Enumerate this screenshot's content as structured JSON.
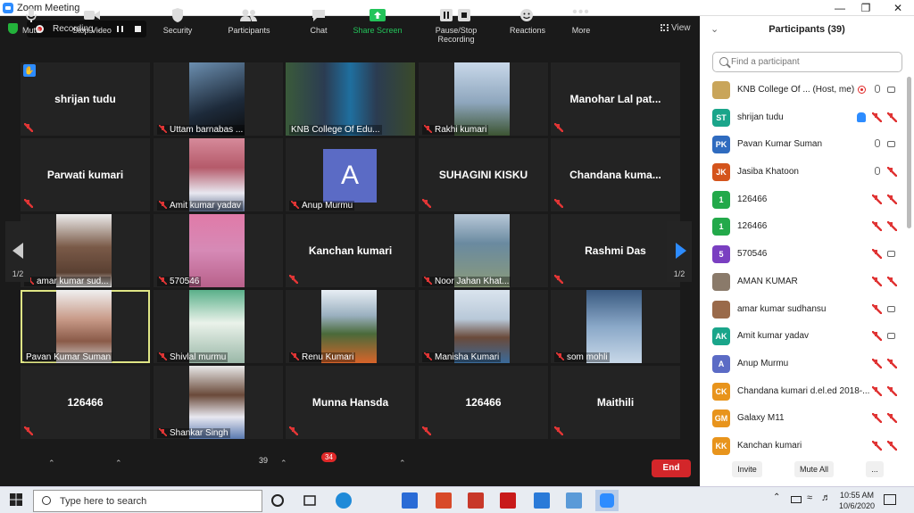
{
  "window": {
    "title": "Zoom Meeting"
  },
  "recording": {
    "label": "Recording..."
  },
  "view": {
    "label": "View"
  },
  "tiles": [
    {
      "name": "shrijan tudu",
      "label": ""
    },
    {
      "name": "",
      "label": "Uttam barnabas ..."
    },
    {
      "name": "",
      "label": "KNB College Of Edu..."
    },
    {
      "name": "",
      "label": "Rakhi kumari"
    },
    {
      "name": "Manohar Lal pat...",
      "label": ""
    },
    {
      "name": "Parwati kumari",
      "label": ""
    },
    {
      "name": "",
      "label": "Amit kumar yadav"
    },
    {
      "name": "",
      "label": "Anup Murmu",
      "avatar": "A"
    },
    {
      "name": "SUHAGINI KISKU",
      "label": ""
    },
    {
      "name": "Chandana kuma...",
      "label": ""
    },
    {
      "name": "",
      "label": "amar kumar sud..."
    },
    {
      "name": "",
      "label": "570546"
    },
    {
      "name": "Kanchan kumari",
      "label": ""
    },
    {
      "name": "",
      "label": "Noor Jahan Khat..."
    },
    {
      "name": "Rashmi Das",
      "label": ""
    },
    {
      "name": "",
      "label": "Pavan Kumar Suman"
    },
    {
      "name": "",
      "label": "Shivlal murmu"
    },
    {
      "name": "",
      "label": "Renu Kumari"
    },
    {
      "name": "",
      "label": "Manisha Kumari"
    },
    {
      "name": "",
      "label": "som mohli"
    },
    {
      "name": "126466",
      "label": ""
    },
    {
      "name": "",
      "label": "Shankar Singh"
    },
    {
      "name": "Munna Hansda",
      "label": ""
    },
    {
      "name": "126466",
      "label": ""
    },
    {
      "name": "Maithili",
      "label": ""
    }
  ],
  "pager": {
    "left": "1/2",
    "right": "1/2"
  },
  "toolbar": {
    "mute": "Mute",
    "stop_video": "Stop Video",
    "security": "Security",
    "participants": "Participants",
    "participants_count": "39",
    "chat": "Chat",
    "chat_badge": "34",
    "share_screen": "Share Screen",
    "pause_stop_recording": "Pause/Stop Recording",
    "reactions": "Reactions",
    "more": "More",
    "end": "End"
  },
  "panel": {
    "title": "Participants (39)",
    "search_placeholder": "Find a participant",
    "invite": "Invite",
    "mute_all": "Mute All",
    "more": "...",
    "participants": [
      {
        "initials": "",
        "name": "KNB College Of ... (Host, me)",
        "color": "#c9a55a",
        "mic": "on",
        "cam": "on",
        "extra": "rec"
      },
      {
        "initials": "ST",
        "name": "shrijan tudu",
        "color": "#1aa58a",
        "mic": "muted",
        "cam": "off",
        "extra": "hand"
      },
      {
        "initials": "PK",
        "name": "Pavan Kumar Suman",
        "color": "#2f6bbf",
        "mic": "on",
        "cam": "on",
        "extra": ""
      },
      {
        "initials": "JK",
        "name": "Jasiba Khatoon",
        "color": "#d4541c",
        "mic": "on",
        "cam": "off",
        "extra": ""
      },
      {
        "initials": "1",
        "name": "126466",
        "color": "#23a94a",
        "mic": "muted",
        "cam": "off",
        "extra": ""
      },
      {
        "initials": "1",
        "name": "126466",
        "color": "#23a94a",
        "mic": "muted",
        "cam": "off",
        "extra": ""
      },
      {
        "initials": "5",
        "name": "570546",
        "color": "#7a3fc1",
        "mic": "muted",
        "cam": "on",
        "extra": ""
      },
      {
        "initials": "",
        "name": "AMAN KUMAR",
        "color": "#8a7a6a",
        "mic": "muted",
        "cam": "off",
        "extra": ""
      },
      {
        "initials": "",
        "name": "amar kumar sudhansu",
        "color": "#9a6a4a",
        "mic": "muted",
        "cam": "on",
        "extra": ""
      },
      {
        "initials": "AK",
        "name": "Amit kumar yadav",
        "color": "#1aa58a",
        "mic": "muted",
        "cam": "on",
        "extra": ""
      },
      {
        "initials": "A",
        "name": "Anup Murmu",
        "color": "#5b6bc5",
        "mic": "muted",
        "cam": "off",
        "extra": ""
      },
      {
        "initials": "CK",
        "name": "Chandana kumari d.el.ed 2018-...",
        "color": "#e8941c",
        "mic": "muted",
        "cam": "off",
        "extra": ""
      },
      {
        "initials": "GM",
        "name": "Galaxy M11",
        "color": "#e8941c",
        "mic": "muted",
        "cam": "off",
        "extra": ""
      },
      {
        "initials": "KK",
        "name": "Kanchan kumari",
        "color": "#e8941c",
        "mic": "muted",
        "cam": "off",
        "extra": ""
      }
    ]
  },
  "taskbar": {
    "search_placeholder": "Type here to search",
    "time": "10:55 AM",
    "date": "10/6/2020"
  }
}
